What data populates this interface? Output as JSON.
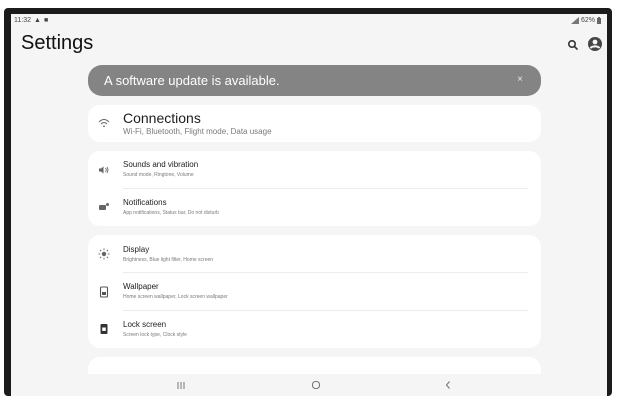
{
  "status_bar": {
    "time": "11:32",
    "battery": "62%"
  },
  "header": {
    "title": "Settings"
  },
  "icons": {
    "search": "search-icon",
    "account": "account-icon",
    "close": "close-icon",
    "wifi": "wifi-icon",
    "sound": "volume-icon",
    "notifications": "notifications-icon",
    "display": "brightness-icon",
    "wallpaper": "wallpaper-icon",
    "lock": "lock-icon"
  },
  "banner": {
    "text": "A software update is available.",
    "close": "×"
  },
  "cards": {
    "connections": {
      "title": "Connections",
      "subtitle": "Wi-Fi, Bluetooth, Flight mode, Data usage"
    },
    "sound_notif": [
      {
        "title": "Sounds and vibration",
        "subtitle": "Sound mode, Ringtone, Volume"
      },
      {
        "title": "Notifications",
        "subtitle": "App notifications, Status bar, Do not disturb"
      }
    ],
    "display_group": [
      {
        "title": "Display",
        "subtitle": "Brightness, Blue light filter, Home screen"
      },
      {
        "title": "Wallpaper",
        "subtitle": "Home screen wallpaper, Lock screen wallpaper"
      },
      {
        "title": "Lock screen",
        "subtitle": "Screen lock type, Clock style"
      }
    ]
  },
  "nav": {
    "recents": "|||",
    "home": "O",
    "back": "<"
  },
  "colors": {
    "banner_bg": "#848484",
    "screen_bg": "#f5f5f5",
    "card_bg": "#ffffff",
    "bezel": "#1b1b1b"
  }
}
